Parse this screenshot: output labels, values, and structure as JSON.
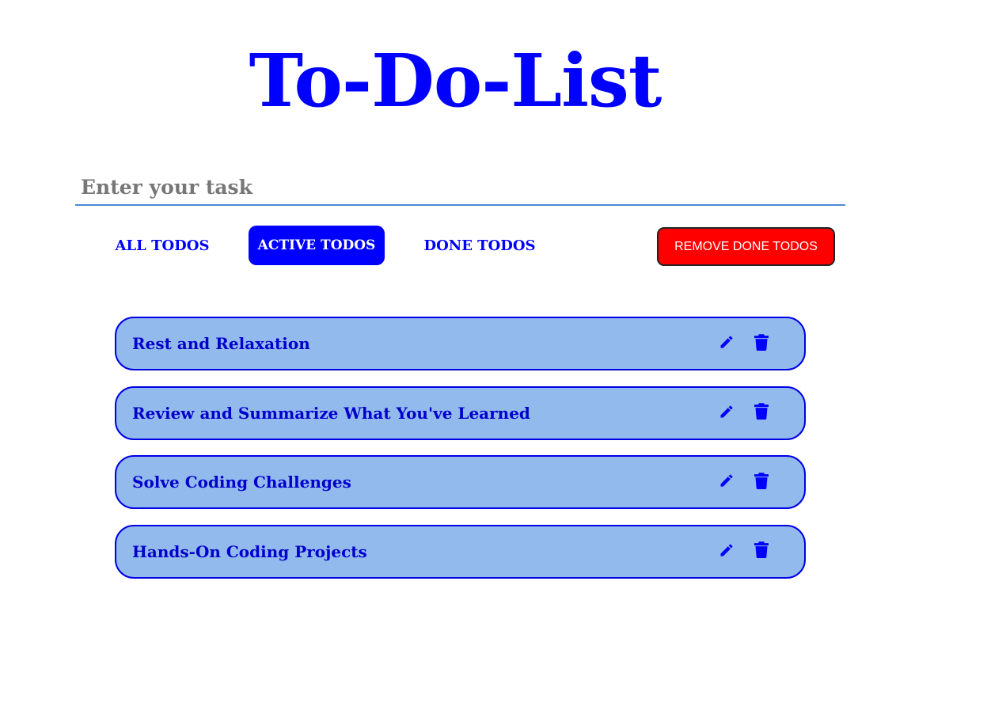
{
  "header": {
    "title": "To-Do-List"
  },
  "task_input": {
    "placeholder": "Enter your task",
    "value": ""
  },
  "filters": {
    "all_label": "ALL TODOS",
    "active_label": "ACTIVE TODOS",
    "done_label": "DONE TODOS",
    "selected": "ACTIVE TODOS"
  },
  "remove_done_label": "REMOVE DONE TODOS",
  "todos": [
    {
      "text": "Rest and Relaxation"
    },
    {
      "text": "Review and Summarize What You've Learned"
    },
    {
      "text": "Solve Coding Challenges"
    },
    {
      "text": "Hands-On Coding Projects"
    }
  ],
  "icons": {
    "edit": "pencil-icon",
    "delete": "trash-icon"
  },
  "colors": {
    "accent": "#0000ff",
    "item_background": "#93baed",
    "danger": "#ff0000",
    "input_underline": "#4a8ad8"
  }
}
